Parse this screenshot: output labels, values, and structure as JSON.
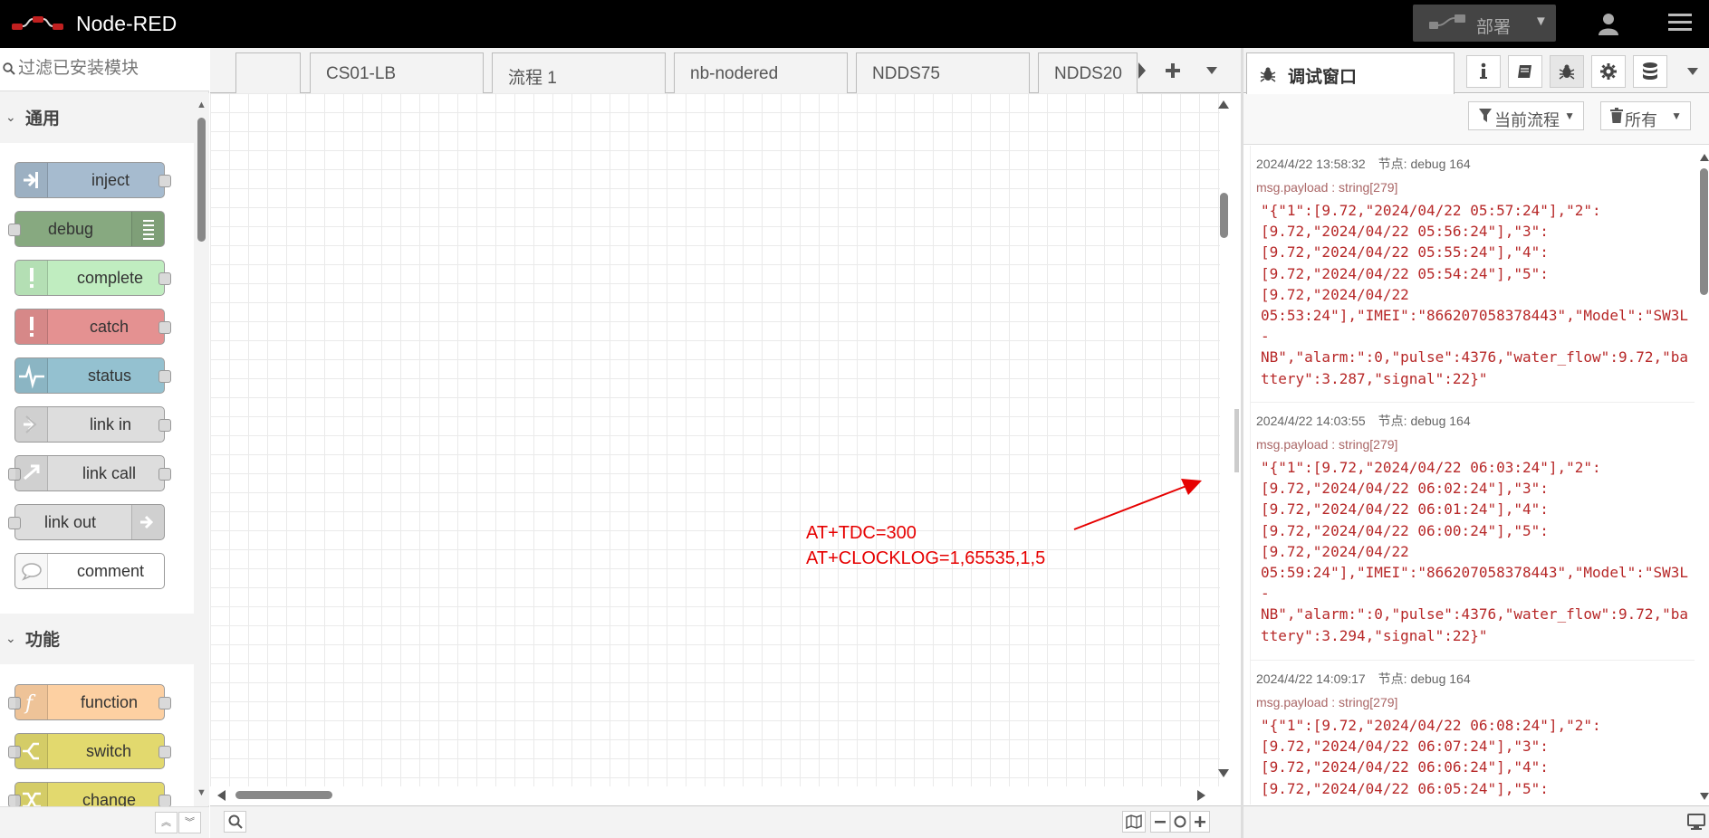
{
  "header": {
    "title": "Node-RED",
    "deploy_label": "部署"
  },
  "palette": {
    "search_placeholder": "过滤已安装模块",
    "categories": [
      {
        "label": "通用",
        "nodes": [
          {
            "label": "inject",
            "color": "#a6bbcf"
          },
          {
            "label": "debug",
            "color": "#87a980"
          },
          {
            "label": "complete",
            "color": "#c0edc0"
          },
          {
            "label": "catch",
            "color": "#e49191"
          },
          {
            "label": "status",
            "color": "#94c1d0"
          },
          {
            "label": "link in",
            "color": "#dddddd"
          },
          {
            "label": "link call",
            "color": "#dddddd"
          },
          {
            "label": "link out",
            "color": "#dddddd"
          },
          {
            "label": "comment",
            "color": "#ffffff"
          }
        ]
      },
      {
        "label": "功能",
        "nodes": [
          {
            "label": "function",
            "color": "#fdd0a2"
          },
          {
            "label": "switch",
            "color": "#e2d96e"
          },
          {
            "label": "change",
            "color": "#e2d96e"
          }
        ]
      }
    ]
  },
  "workspace": {
    "tabs": [
      {
        "label": ""
      },
      {
        "label": "CS01-LB"
      },
      {
        "label": "流程 1"
      },
      {
        "label": "nb-nodered"
      },
      {
        "label": "NDDS75"
      },
      {
        "label": "NDDS20"
      }
    ],
    "annotation": {
      "line1": "AT+TDC=300",
      "line2": "AT+CLOCKLOG=1,65535,1,5",
      "color": "#e60000"
    }
  },
  "sidebar": {
    "active_tab_label": "调试窗口",
    "filter_label": "当前流程",
    "clear_label": "所有",
    "messages": [
      {
        "timestamp": "2024/4/22 13:58:32",
        "node": "节点: debug 164",
        "type": "msg.payload : string[279]",
        "payload": "\"{\"1\":[9.72,\"2024/04/22 05:57:24\"],\"2\":\n[9.72,\"2024/04/22 05:56:24\"],\"3\":\n[9.72,\"2024/04/22 05:55:24\"],\"4\":\n[9.72,\"2024/04/22 05:54:24\"],\"5\":\n[9.72,\"2024/04/22\n05:53:24\"],\"IMEI\":\"866207058378443\",\"Model\":\"SW3L-\nNB\",\"alarm:\":0,\"pulse\":4376,\"water_flow\":9.72,\"battery\":3.287,\"signal\":22}\""
      },
      {
        "timestamp": "2024/4/22 14:03:55",
        "node": "节点: debug 164",
        "type": "msg.payload : string[279]",
        "payload": "\"{\"1\":[9.72,\"2024/04/22 06:03:24\"],\"2\":\n[9.72,\"2024/04/22 06:02:24\"],\"3\":\n[9.72,\"2024/04/22 06:01:24\"],\"4\":\n[9.72,\"2024/04/22 06:00:24\"],\"5\":\n[9.72,\"2024/04/22\n05:59:24\"],\"IMEI\":\"866207058378443\",\"Model\":\"SW3L-\nNB\",\"alarm:\":0,\"pulse\":4376,\"water_flow\":9.72,\"battery\":3.294,\"signal\":22}\""
      },
      {
        "timestamp": "2024/4/22 14:09:17",
        "node": "节点: debug 164",
        "type": "msg.payload : string[279]",
        "payload": "\"{\"1\":[9.72,\"2024/04/22 06:08:24\"],\"2\":\n[9.72,\"2024/04/22 06:07:24\"],\"3\":\n[9.72,\"2024/04/22 06:06:24\"],\"4\":\n[9.72,\"2024/04/22 06:05:24\"],\"5\":"
      }
    ]
  }
}
